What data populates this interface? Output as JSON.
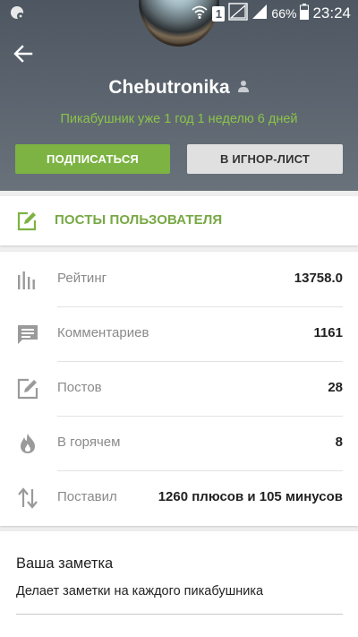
{
  "status_bar": {
    "battery_percent": "66%",
    "time": "23:24",
    "sim_label": "1"
  },
  "header": {
    "username": "Chebutronika",
    "member_since": "Пикабушник уже 1 год 1 неделю 6 дней",
    "subscribe_label": "ПОДПИСАТЬСЯ",
    "ignore_label": "В ИГНОР-ЛИСТ"
  },
  "posts_link": {
    "label": "ПОСТЫ ПОЛЬЗОВАТЕЛЯ"
  },
  "stats": [
    {
      "icon": "chart-bars-icon",
      "label": "Рейтинг",
      "value": "13758.0"
    },
    {
      "icon": "comment-icon",
      "label": "Комментариев",
      "value": "1161"
    },
    {
      "icon": "edit-icon",
      "label": "Постов",
      "value": "28"
    },
    {
      "icon": "flame-icon",
      "label": "В горячем",
      "value": "8"
    },
    {
      "icon": "sort-arrows-icon",
      "label": "Поставил",
      "value": "1260 плюсов и 105 минусов"
    }
  ],
  "note": {
    "title": "Ваша заметка",
    "text": "Делает заметки на каждого пикабушника"
  },
  "colors": {
    "accent_green": "#7cb342",
    "green_text": "#8bc34a"
  }
}
